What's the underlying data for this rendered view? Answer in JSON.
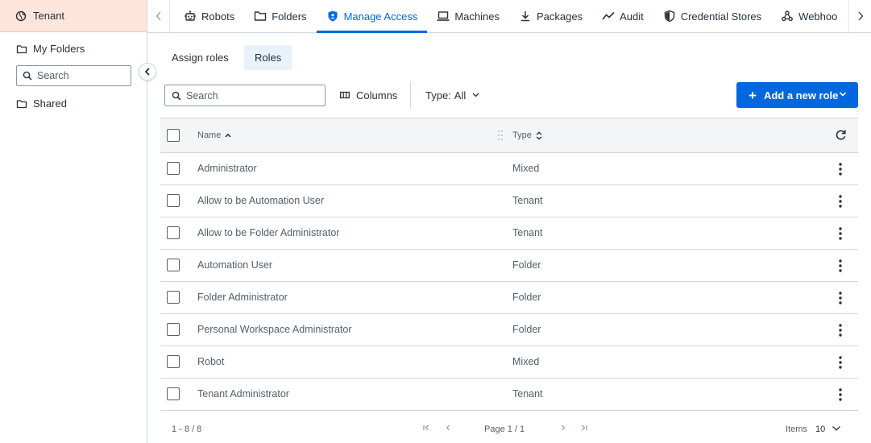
{
  "sidebar": {
    "tenant_label": "Tenant",
    "my_folders_label": "My Folders",
    "search_placeholder": "Search",
    "shared_label": "Shared"
  },
  "nav": {
    "tabs": [
      {
        "label": "Robots",
        "icon": "robot-icon"
      },
      {
        "label": "Folders",
        "icon": "folder-icon"
      },
      {
        "label": "Manage Access",
        "icon": "shield-icon",
        "active": true
      },
      {
        "label": "Machines",
        "icon": "laptop-icon"
      },
      {
        "label": "Packages",
        "icon": "download-icon"
      },
      {
        "label": "Audit",
        "icon": "trend-icon"
      },
      {
        "label": "Credential Stores",
        "icon": "shield-filled-icon"
      },
      {
        "label": "Webhoo",
        "icon": "webhook-icon"
      }
    ]
  },
  "subtabs": {
    "assign_roles": "Assign roles",
    "roles": "Roles"
  },
  "toolbar": {
    "search_placeholder": "Search",
    "columns_label": "Columns",
    "type_label": "Type:",
    "type_value": "All",
    "add_role_label": "Add a new role"
  },
  "table": {
    "headers": {
      "name": "Name",
      "type": "Type"
    },
    "rows": [
      {
        "name": "Administrator",
        "type": "Mixed"
      },
      {
        "name": "Allow to be Automation User",
        "type": "Tenant"
      },
      {
        "name": "Allow to be Folder Administrator",
        "type": "Tenant"
      },
      {
        "name": "Automation User",
        "type": "Folder"
      },
      {
        "name": "Folder Administrator",
        "type": "Folder"
      },
      {
        "name": "Personal Workspace Administrator",
        "type": "Folder"
      },
      {
        "name": "Robot",
        "type": "Mixed"
      },
      {
        "name": "Tenant Administrator",
        "type": "Tenant"
      }
    ]
  },
  "pager": {
    "range": "1 - 8 / 8",
    "page_info": "Page 1 / 1",
    "items_label": "Items",
    "items_value": "10"
  },
  "colors": {
    "accent": "#0067df",
    "tenant_bg": "#fde5dc",
    "header_bg": "#f4f5f7"
  }
}
